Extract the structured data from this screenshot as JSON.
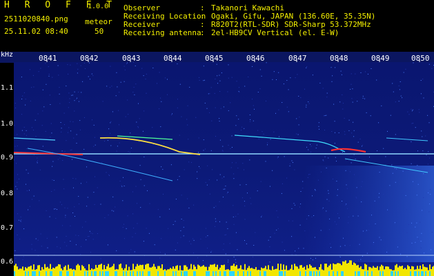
{
  "header": {
    "app_name": "H R O F F T",
    "version": "1.0.0",
    "filename": "2511020840.png",
    "meteor_label": "meteor",
    "timestamp": "25.11.02 08:40",
    "meteor_count": "50",
    "info": [
      {
        "label": "Observer",
        "sep": ":",
        "value": "Takanori Kawachi"
      },
      {
        "label": "Receiving Location",
        "sep": ":",
        "value": "Ogaki, Gifu, JAPAN (136.60E, 35.35N)"
      },
      {
        "label": "Receiver",
        "sep": ":",
        "value": "R820T2(RTL-SDR) SDR-Sharp 53.372MHz"
      },
      {
        "label": "Receiving antenna",
        "sep": ":",
        "value": "2el-HB9CV Vertical (el. E-W)"
      }
    ]
  },
  "axis": {
    "unit": "kHz",
    "time_ticks": [
      "0841",
      "0842",
      "0843",
      "0844",
      "0845",
      "0846",
      "0847",
      "0848",
      "0849",
      "0850"
    ],
    "freq_ticks": [
      "1.1",
      "1.0",
      "0.9",
      "0.8",
      "0.7",
      "0.6"
    ]
  },
  "colors": {
    "accent_yellow": "#f4f000",
    "spectrum_bg": "#0a1a6a"
  }
}
